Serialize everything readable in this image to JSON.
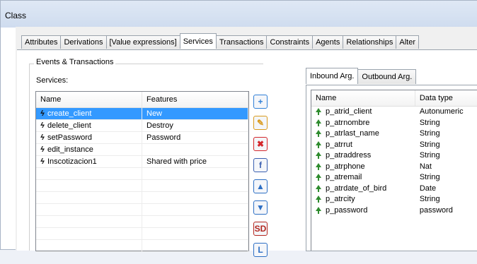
{
  "window": {
    "title": "Class"
  },
  "tabs": [
    "Attributes",
    "Derivations",
    "[Value expressions]",
    "Services",
    "Transactions",
    "Constraints",
    "Agents",
    "Relationships",
    "Alter"
  ],
  "active_tab": "Services",
  "group": {
    "label": "Events & Transactions",
    "services_label": "Services:"
  },
  "services": {
    "columns": [
      "Name",
      "Features"
    ],
    "rows": [
      {
        "name": "create_client",
        "features": "New",
        "selected": true
      },
      {
        "name": "delete_client",
        "features": "Destroy"
      },
      {
        "name": "setPassword",
        "features": "Password"
      },
      {
        "name": "edit_instance",
        "features": ""
      },
      {
        "name": "Inscotizacion1",
        "features": "Shared with price"
      }
    ]
  },
  "toolbar": [
    {
      "icon": "add-icon",
      "color": "#2f7fd6",
      "glyph": "+"
    },
    {
      "icon": "edit-icon",
      "color": "#d99a1c",
      "glyph": "✎"
    },
    {
      "icon": "delete-icon",
      "color": "#d4262a",
      "glyph": "✖"
    },
    {
      "icon": "formula-icon",
      "color": "#3a5fb0",
      "glyph": "f"
    },
    {
      "icon": "move-up-icon",
      "color": "#2d6fc4",
      "glyph": "▲"
    },
    {
      "icon": "move-down-icon",
      "color": "#2d6fc4",
      "glyph": "▼"
    },
    {
      "icon": "rename-icon",
      "color": "#b3261e",
      "glyph": "SD"
    },
    {
      "icon": "tree-icon",
      "color": "#2d6fc4",
      "glyph": "L"
    }
  ],
  "args_tabs": [
    "Inbound Arg.",
    "Outbound Arg."
  ],
  "args": {
    "columns": [
      "Name",
      "Data type"
    ],
    "rows": [
      {
        "name": "p_atrid_client",
        "type": "Autonumeric"
      },
      {
        "name": "p_atrnombre",
        "type": "String"
      },
      {
        "name": "p_atrlast_name",
        "type": "String"
      },
      {
        "name": "p_atrrut",
        "type": "String"
      },
      {
        "name": "p_atraddress",
        "type": "String"
      },
      {
        "name": "p_atrphone",
        "type": "Nat"
      },
      {
        "name": "p_atremail",
        "type": "String"
      },
      {
        "name": "p_atrdate_of_bird",
        "type": "Date"
      },
      {
        "name": "p_atrcity",
        "type": "String"
      },
      {
        "name": "p_password",
        "type": "password"
      }
    ]
  }
}
